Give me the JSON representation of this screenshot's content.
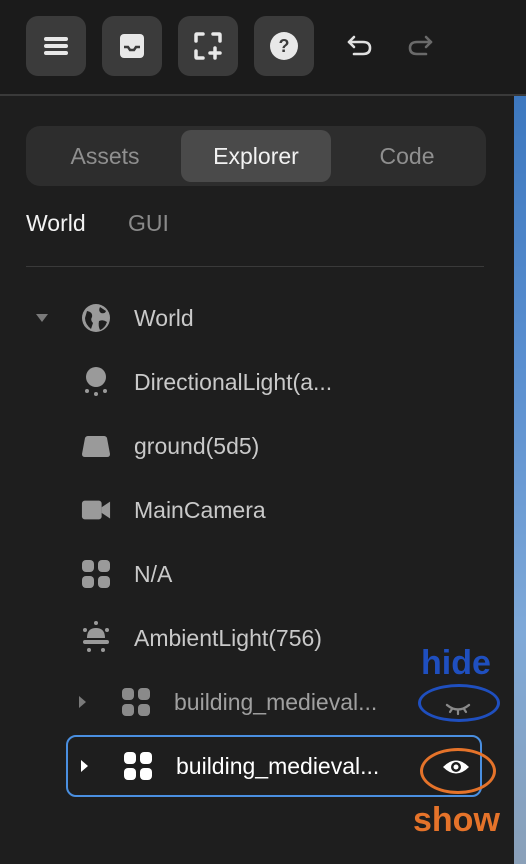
{
  "toolbar": {
    "buttons": [
      "menu-icon",
      "inbox-icon",
      "fit-screen-add-icon",
      "help-icon"
    ],
    "undo_icon": "undo-icon",
    "redo_icon": "redo-icon"
  },
  "tabs": [
    {
      "label": "Assets",
      "active": false
    },
    {
      "label": "Explorer",
      "active": true
    },
    {
      "label": "Code",
      "active": false
    }
  ],
  "subtabs": [
    {
      "label": "World",
      "active": true
    },
    {
      "label": "GUI",
      "active": false
    }
  ],
  "tree": [
    {
      "label": "World",
      "icon": "globe-icon",
      "expanded": true
    },
    {
      "label": "DirectionalLight(a...",
      "icon": "directional-light-icon"
    },
    {
      "label": "ground(5d5)",
      "icon": "ground-icon"
    },
    {
      "label": "MainCamera",
      "icon": "camera-icon"
    },
    {
      "label": "N/A",
      "icon": "grid-object-icon"
    },
    {
      "label": "AmbientLight(756)",
      "icon": "ambient-light-icon"
    },
    {
      "label": "building_medieval...",
      "icon": "grid-object-icon",
      "collapsed": true,
      "visibility": "hidden"
    },
    {
      "label": "building_medieval...",
      "icon": "grid-object-icon",
      "collapsed": true,
      "visibility": "visible",
      "selected": true
    }
  ],
  "annotations": {
    "hide_label": "hide",
    "show_label": "show",
    "hide_color": "#1f4fbf",
    "show_color": "#e5732a"
  },
  "colors": {
    "accent": "#4a8fe0",
    "panel_bg": "#1e1e1e"
  }
}
